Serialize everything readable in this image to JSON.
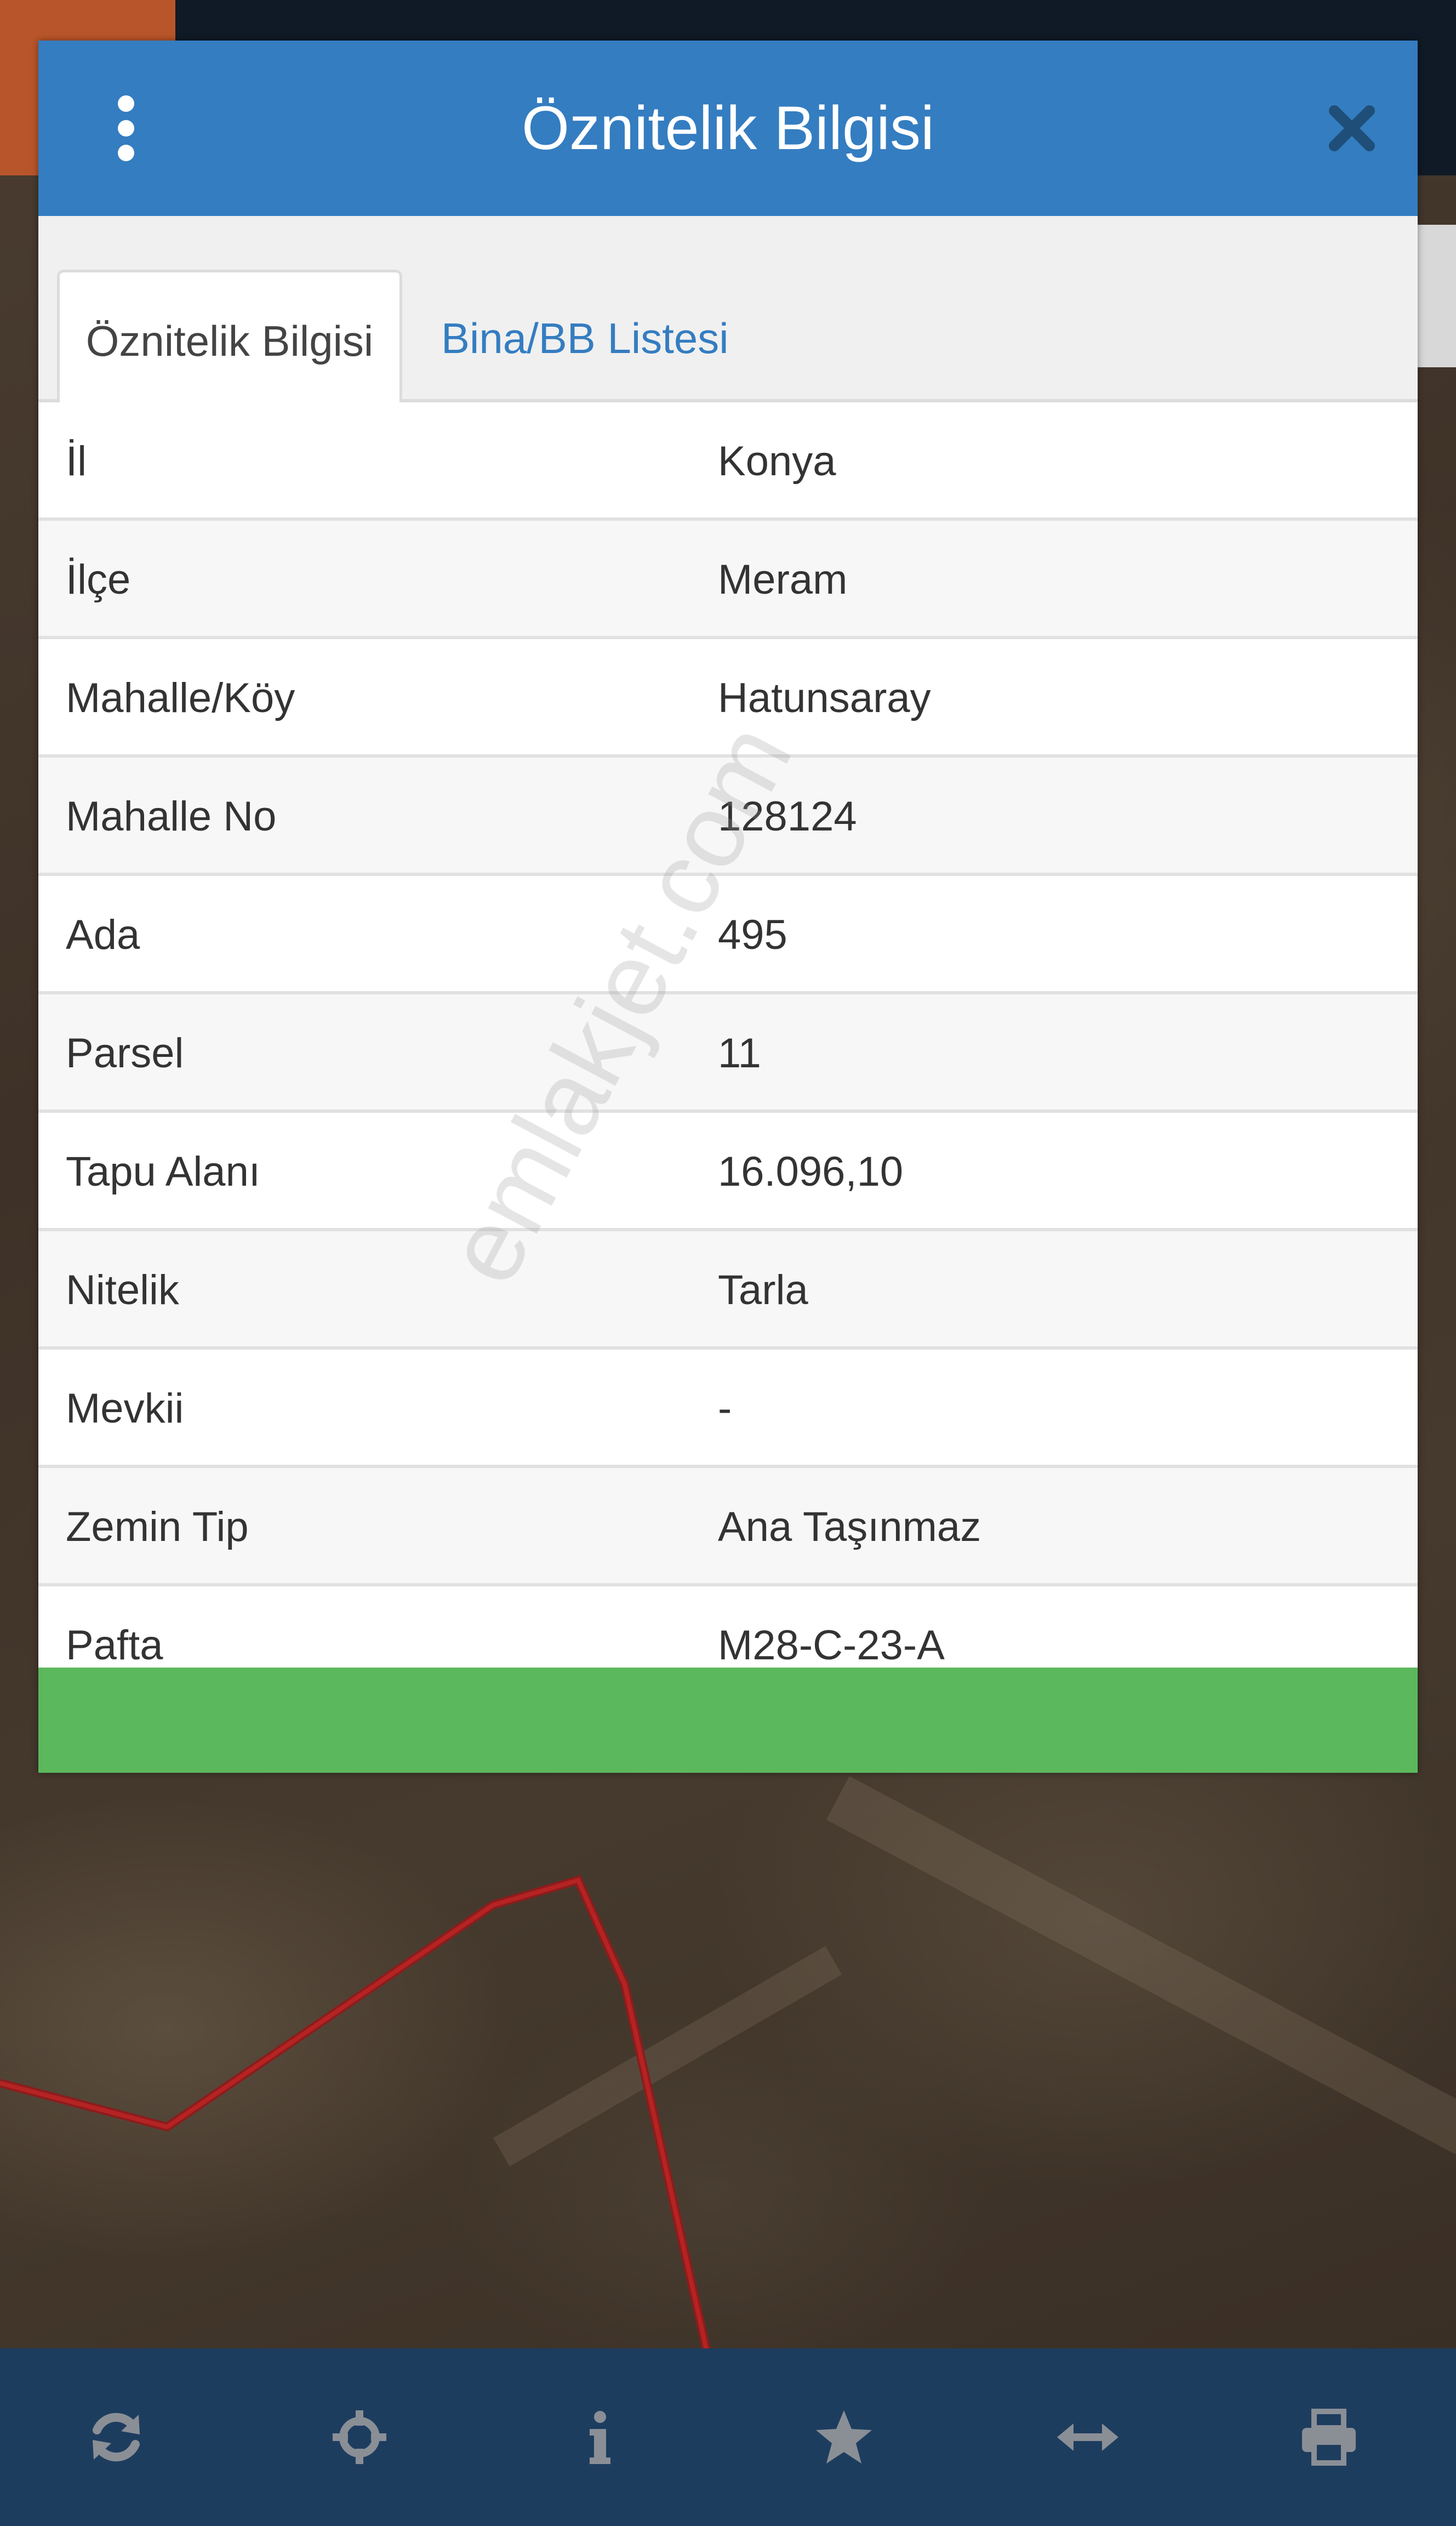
{
  "modal": {
    "title": "Öznitelik Bilgisi",
    "menu_icon": "kebab-menu-icon",
    "close_icon": "close-icon",
    "header_color": "#347dc1",
    "footer_color": "#5cb85c"
  },
  "tabs": [
    {
      "label": "Öznitelik Bilgisi",
      "active": true
    },
    {
      "label": "Bina/BB Listesi",
      "active": false
    }
  ],
  "attributes": [
    {
      "key": "İl",
      "value": "Konya"
    },
    {
      "key": "İlçe",
      "value": "Meram"
    },
    {
      "key": "Mahalle/Köy",
      "value": "Hatunsaray"
    },
    {
      "key": "Mahalle No",
      "value": "128124"
    },
    {
      "key": "Ada",
      "value": "495"
    },
    {
      "key": "Parsel",
      "value": "11"
    },
    {
      "key": "Tapu Alanı",
      "value": "16.096,10"
    },
    {
      "key": "Nitelik",
      "value": "Tarla"
    },
    {
      "key": "Mevkii",
      "value": "-"
    },
    {
      "key": "Zemin Tip",
      "value": "Ana Taşınmaz"
    },
    {
      "key": "Pafta",
      "value": "M28-C-23-A"
    }
  ],
  "watermark": "emlakjet.com",
  "toolbar": {
    "background": "#1d3d5f",
    "icons": [
      "refresh-icon",
      "locate-crosshair-icon",
      "info-icon",
      "star-icon",
      "measure-arrows-icon",
      "print-icon"
    ]
  }
}
